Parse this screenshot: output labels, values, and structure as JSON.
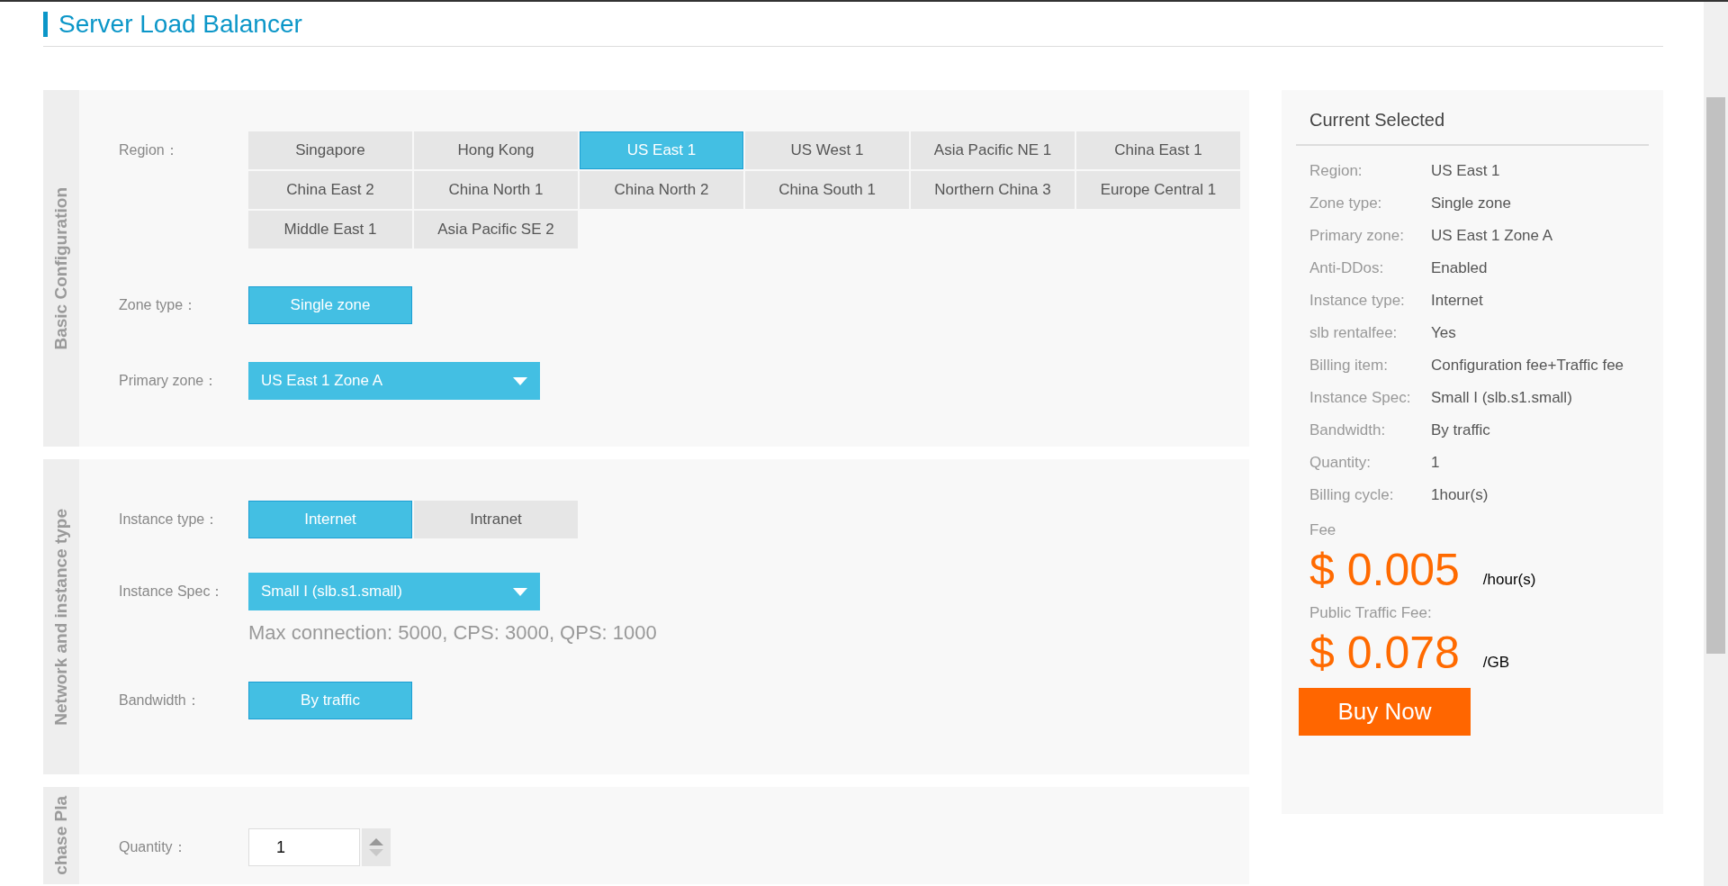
{
  "page": {
    "title": "Server Load Balancer"
  },
  "sections": [
    {
      "heading": "Basic Configuration",
      "rows": [
        {
          "kind": "options",
          "label": "Region：",
          "options": [
            {
              "label": "Singapore",
              "selected": false
            },
            {
              "label": "Hong Kong",
              "selected": false
            },
            {
              "label": "US East 1",
              "selected": true
            },
            {
              "label": "US West 1",
              "selected": false
            },
            {
              "label": "Asia Pacific NE 1",
              "selected": false
            },
            {
              "label": "China East 1",
              "selected": false
            },
            {
              "label": "China East 2",
              "selected": false
            },
            {
              "label": "China North 1",
              "selected": false
            },
            {
              "label": "China North 2",
              "selected": false
            },
            {
              "label": "China South 1",
              "selected": false
            },
            {
              "label": "Northern China 3",
              "selected": false
            },
            {
              "label": "Europe Central 1",
              "selected": false
            },
            {
              "label": "Middle East 1",
              "selected": false
            },
            {
              "label": "Asia Pacific SE 2",
              "selected": false
            }
          ]
        },
        {
          "kind": "options",
          "label": "Zone type：",
          "options": [
            {
              "label": "Single zone",
              "selected": true
            }
          ]
        },
        {
          "kind": "dropdown",
          "label": "Primary zone：",
          "value": "US East 1 Zone A"
        }
      ]
    },
    {
      "heading": "Network and instance type",
      "rows": [
        {
          "kind": "options",
          "label": "Instance type：",
          "options": [
            {
              "label": "Internet",
              "selected": true
            },
            {
              "label": "Intranet",
              "selected": false
            }
          ]
        },
        {
          "kind": "dropdown",
          "label": "Instance Spec：",
          "value": "Small I (slb.s1.small)",
          "note": "Max connection: 5000, CPS: 3000, QPS: 1000"
        },
        {
          "kind": "options",
          "label": "Bandwidth：",
          "options": [
            {
              "label": "By traffic",
              "selected": true
            }
          ]
        }
      ]
    },
    {
      "heading": "chase Pla",
      "rows": [
        {
          "kind": "number",
          "label": "Quantity：",
          "value": "1"
        }
      ]
    }
  ],
  "summary": {
    "title": "Current Selected",
    "items": [
      {
        "label": "Region:",
        "value": "US East 1"
      },
      {
        "label": "Zone type:",
        "value": "Single zone"
      },
      {
        "label": "Primary zone:",
        "value": "US East 1 Zone A"
      },
      {
        "label": "Anti-DDos:",
        "value": "Enabled"
      },
      {
        "label": "Instance type:",
        "value": "Internet"
      },
      {
        "label": "slb rentalfee:",
        "value": "Yes"
      },
      {
        "label": "Billing item:",
        "value": "Configuration fee+Traffic fee"
      },
      {
        "label": "Instance Spec:",
        "value": "Small I (slb.s1.small)"
      },
      {
        "label": "Bandwidth:",
        "value": "By traffic"
      },
      {
        "label": "Quantity:",
        "value": "1"
      },
      {
        "label": "Billing cycle:",
        "value": "1hour(s)"
      }
    ],
    "fees": [
      {
        "label": "Fee",
        "price": "$ 0.005",
        "unit": "/hour(s)"
      },
      {
        "label": "Public Traffic Fee:",
        "price": "$ 0.078",
        "unit": "/GB"
      }
    ],
    "button": "Buy Now"
  }
}
